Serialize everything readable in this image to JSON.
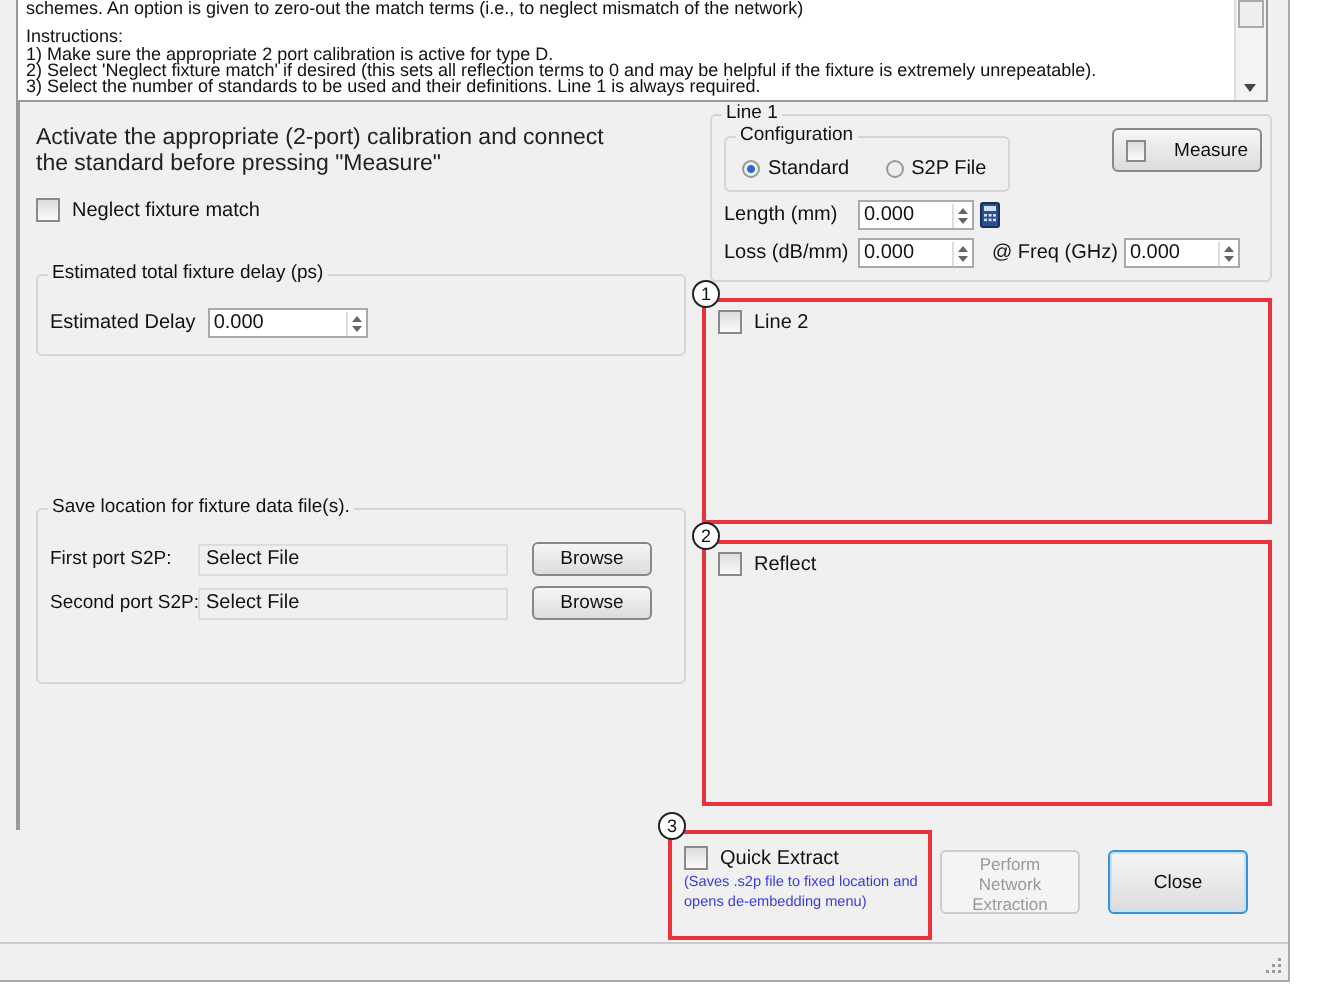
{
  "description": {
    "intro": "schemes. An option is given to zero-out the match terms (i.e., to neglect mismatch of the network)",
    "lines": [
      "Instructions:",
      "1) Make sure the appropriate 2 port calibration is active for type D.",
      "2) Select 'Neglect fixture match' if desired (this sets all reflection terms to 0 and may be helpful if the fixture is extremely unrepeatable).",
      "3) Select the number of standards to be used and their definitions. Line 1 is always required."
    ]
  },
  "instruction": "Activate the appropriate (2-port) calibration and connect the standard before pressing \"Measure\"",
  "neglect_fixture_match": {
    "label": "Neglect fixture match",
    "checked": false
  },
  "delay_group": {
    "title": "Estimated total fixture delay (ps)",
    "label": "Estimated Delay",
    "value": "0.000"
  },
  "save_group": {
    "title": "Save location for fixture data file(s).",
    "rows": [
      {
        "label": "First port S2P:",
        "value": "Select File",
        "button": "Browse"
      },
      {
        "label": "Second port S2P:",
        "value": "Select File",
        "button": "Browse"
      }
    ]
  },
  "line1": {
    "title": "Line 1",
    "configuration": {
      "title": "Configuration",
      "options": [
        {
          "label": "Standard",
          "selected": true
        },
        {
          "label": "S2P File",
          "selected": false
        }
      ]
    },
    "measure": {
      "label": "Measure",
      "checked": false
    },
    "length": {
      "label": "Length (mm)",
      "value": "0.000"
    },
    "loss": {
      "label": "Loss (dB/mm)",
      "value": "0.000"
    },
    "freq": {
      "label": "@ Freq (GHz)",
      "value": "0.000"
    }
  },
  "standards": [
    {
      "number": "1",
      "label": "Line 2",
      "checked": false
    },
    {
      "number": "2",
      "label": "Reflect",
      "checked": false
    }
  ],
  "quick_extract": {
    "number": "3",
    "label": "Quick Extract",
    "checked": false,
    "note": "(Saves .s2p file to fixed location and opens de-embedding menu)"
  },
  "buttons": [
    {
      "label": "Perform Network Extraction",
      "disabled": true
    },
    {
      "label": "Close",
      "disabled": false
    }
  ]
}
